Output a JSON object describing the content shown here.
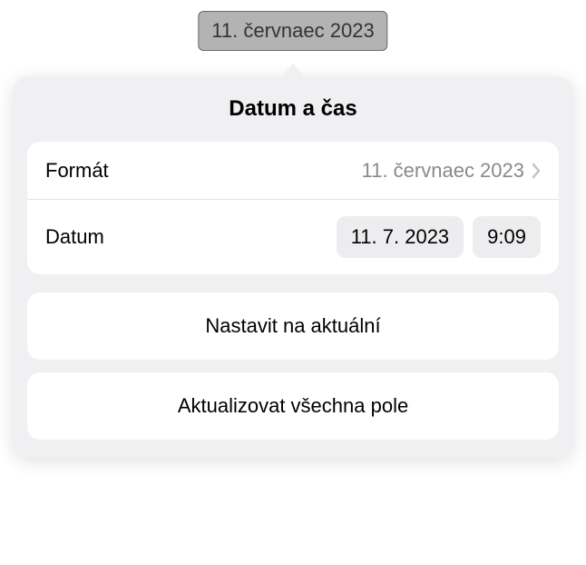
{
  "token": {
    "text": "11. červnaec 2023"
  },
  "popover": {
    "title": "Datum a čas",
    "format": {
      "label": "Formát",
      "value": "11. červnaec 2023"
    },
    "datum": {
      "label": "Datum",
      "date_value": "11. 7. 2023",
      "time_value": "9:09"
    },
    "actions": {
      "set_current": "Nastavit na aktuální",
      "update_all": "Aktualizovat všechna pole"
    }
  }
}
